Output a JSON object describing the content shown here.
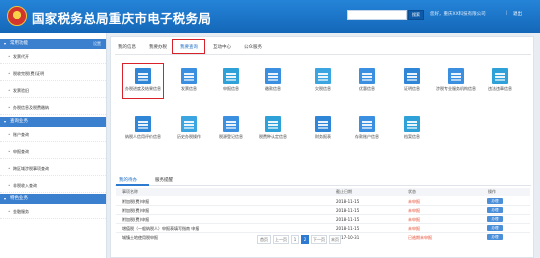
{
  "header": {
    "title": "国家税务总局重庆市电子税务局",
    "search_placeholder": "",
    "search_label": "搜索",
    "user": "您好，重庆XX科技有限公司",
    "separator": "|",
    "logout": "退出"
  },
  "sidebar": {
    "sections": [
      {
        "title": "常用功能",
        "more": "设置",
        "items": [
          "发票代开",
          "税收完税(费)证明",
          "发票验旧",
          "办税信息及税费缴纳"
        ]
      },
      {
        "title": "查询业务",
        "items": [
          "账户查询",
          "申报查询",
          "跨区域涉税事项查询",
          "非税收入查询"
        ]
      },
      {
        "title": "特色业务",
        "items": [
          "金融服务"
        ]
      }
    ]
  },
  "tabs": [
    "我的信息",
    "我要办税",
    "我要查询",
    "互动中心",
    "公众服务"
  ],
  "active_tab": "我要查询",
  "functions": [
    {
      "label": "办税进度及结果信息",
      "color": "#2f86d6"
    },
    {
      "label": "发票信息",
      "color": "#3a8fe0"
    },
    {
      "label": "申报信息",
      "color": "#2fa1d9"
    },
    {
      "label": "缴款信息",
      "color": "#3a8fe0"
    },
    {
      "label": "欠税信息",
      "color": "#3aa5e0"
    },
    {
      "label": "优惠信息",
      "color": "#3a8fe0"
    },
    {
      "label": "证明信息",
      "color": "#2f86d6"
    },
    {
      "label": "涉税专业服务机构信息",
      "color": "#3a8fe0"
    },
    {
      "label": "违法违章信息",
      "color": "#2fa1d9"
    },
    {
      "label": "纳税人信用评价信息",
      "color": "#2f86d6"
    },
    {
      "label": "历史办税操作",
      "color": "#3aa5e0"
    },
    {
      "label": "税源登记信息",
      "color": "#3a8fe0"
    },
    {
      "label": "税费种认定信息",
      "color": "#2fa1d9"
    },
    {
      "label": "财务报表",
      "color": "#2f86d6"
    },
    {
      "label": "存款账户信息",
      "color": "#3a8fe0"
    },
    {
      "label": "档案信息",
      "color": "#2fa1d9"
    }
  ],
  "list": {
    "tabs": [
      "我的待办",
      "服务提醒"
    ],
    "columns": [
      "事项名称",
      "截止日期",
      "状态",
      "操作"
    ],
    "rows": [
      {
        "name": "附加税(费)申报",
        "date": "2018-11-15",
        "status": "未申报",
        "action": "办理"
      },
      {
        "name": "附加税(费)申报",
        "date": "2018-11-15",
        "status": "未申报",
        "action": "办理"
      },
      {
        "name": "附加税(费)申报",
        "date": "2018-11-15",
        "status": "未申报",
        "action": "办理"
      },
      {
        "name": "增值税（一般纳税人）申报表填写指南 申报",
        "date": "2018-11-15",
        "status": "未申报",
        "action": "办理"
      },
      {
        "name": "城镇土地使用税申报",
        "date": "2017-10-31",
        "status": "已逾期未申报",
        "action": "办理"
      }
    ]
  },
  "pager": {
    "first": "首页",
    "prev": "上一页",
    "pages": [
      "1",
      "2"
    ],
    "current": "2",
    "next": "下一页",
    "last": "末页"
  },
  "colors": {
    "header": "#1a73c9",
    "accent": "#2e7ad1",
    "highlight": "#d8232a",
    "status": "#e8482c"
  }
}
